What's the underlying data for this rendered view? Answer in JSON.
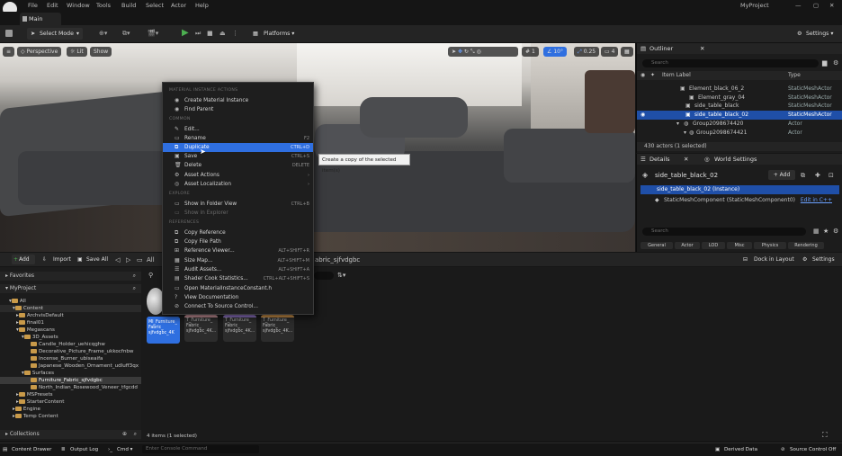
{
  "menu": {
    "items": [
      "File",
      "Edit",
      "Window",
      "Tools",
      "Build",
      "Select",
      "Actor",
      "Help"
    ],
    "project": "MyProject"
  },
  "tab": {
    "level": "Main"
  },
  "toolbar": {
    "select_mode": "Select Mode",
    "platforms": "Platforms",
    "settings": "Settings"
  },
  "viewport": {
    "perspective": "Perspective",
    "lit": "Lit",
    "show": "Show",
    "grid": "1",
    "angle": "10°",
    "scale": "0.25",
    "camera": "4"
  },
  "outliner": {
    "title": "Outliner",
    "search": "Search",
    "col_label": "Item Label",
    "col_type": "Type",
    "rows": [
      {
        "label": "Element_black_06_2",
        "type": "StaticMeshActor"
      },
      {
        "label": "Element_gray_04",
        "type": "StaticMeshActor"
      },
      {
        "label": "side_table_black",
        "type": "StaticMeshActor"
      },
      {
        "label": "side_table_black_02",
        "type": "StaticMeshActor"
      },
      {
        "label": "Group2098674420",
        "type": "Actor"
      },
      {
        "label": "Group2098674421",
        "type": "Actor"
      }
    ],
    "count": "430 actors (1 selected)"
  },
  "details": {
    "title": "Details",
    "world_settings": "World Settings",
    "actor": "side_table_black_02",
    "add": "+ Add",
    "instance": "side_table_black_02 (Instance)",
    "component": "StaticMeshComponent (StaticMeshComponent0)",
    "edit_cpp": "Edit in C++",
    "search": "Search",
    "tabs": [
      "General",
      "Actor",
      "LOD",
      "Misc",
      "Physics",
      "Rendering"
    ]
  },
  "cb": {
    "add": "Add",
    "import": "Import",
    "save_all": "Save All",
    "all": "All",
    "path": "abric_sjfvdgbc",
    "dock": "Dock in Layout",
    "settings": "Settings",
    "favorites": "Favorites",
    "project": "MyProject",
    "collections": "Collections",
    "count": "4 items (1 selected)",
    "tree": [
      "All",
      "Content",
      "ArchvisDefault",
      "final01",
      "Megascans",
      "3D_Assets",
      "Candle_Holder_uehicqghw",
      "Decorative_Picture_Frame_ukkocfnbw",
      "Incense_Burner_ubiseaifa",
      "Japanese_Wooden_Ornament_udluff3qx",
      "Surfaces",
      "Furniture_Fabric_sjfvdgbc",
      "North_Indian_Rosewood_Veneer_tfgcdd",
      "MSPresets",
      "StarterContent",
      "Engine",
      "Temp Content"
    ],
    "assets": [
      {
        "label": "MI_Furniture_\nFabric_\nsjfvdgbc_4K",
        "color": "#2a6ad8"
      },
      {
        "label": "T_Furniture_\nFabric_\nsjfvdgbc_4K...",
        "color": "#d9a0a6"
      },
      {
        "label": "T_Furniture_\nFabric_\nsjfvdgbc_4K...",
        "color": "#9d7fd6"
      },
      {
        "label": "T_Furniture_\nFabric_\nsjfvdgbc_4K...",
        "color": "#e0a050"
      }
    ]
  },
  "ctx": {
    "sections": [
      "MATERIAL INSTANCE ACTIONS",
      "COMMON",
      "EXPLORE",
      "REFERENCES"
    ],
    "items": [
      {
        "label": "Create Material Instance",
        "sc": ""
      },
      {
        "label": "Find Parent",
        "sc": ""
      },
      {
        "label": "Edit...",
        "sc": ""
      },
      {
        "label": "Rename",
        "sc": "F2"
      },
      {
        "label": "Duplicate",
        "sc": "CTRL+D"
      },
      {
        "label": "Save",
        "sc": "CTRL+S"
      },
      {
        "label": "Delete",
        "sc": "DELETE"
      },
      {
        "label": "Asset Actions",
        "sc": "›"
      },
      {
        "label": "Asset Localization",
        "sc": "›"
      },
      {
        "label": "Show in Folder View",
        "sc": "CTRL+B"
      },
      {
        "label": "Show in Explorer",
        "sc": ""
      },
      {
        "label": "Copy Reference",
        "sc": ""
      },
      {
        "label": "Copy File Path",
        "sc": ""
      },
      {
        "label": "Reference Viewer...",
        "sc": "ALT+SHIFT+R"
      },
      {
        "label": "Size Map...",
        "sc": "ALT+SHIFT+M"
      },
      {
        "label": "Audit Assets...",
        "sc": "ALT+SHIFT+A"
      },
      {
        "label": "Shader Cook Statistics...",
        "sc": "CTRL+ALT+SHIFT+S"
      },
      {
        "label": "Open MaterialInstanceConstant.h",
        "sc": ""
      },
      {
        "label": "View Documentation",
        "sc": ""
      },
      {
        "label": "Connect To Source Control...",
        "sc": ""
      }
    ],
    "tooltip": "Create a copy of the selected item(s)"
  },
  "status": {
    "drawer": "Content Drawer",
    "output": "Output Log",
    "cmd": "Cmd",
    "console": "Enter Console Command",
    "derived": "Derived Data",
    "source": "Source Control Off"
  },
  "colors": {
    "accent": "#2f6fe0",
    "selection": "#1f4fa8",
    "folder": "#c99a49",
    "play": "#4caf50"
  }
}
